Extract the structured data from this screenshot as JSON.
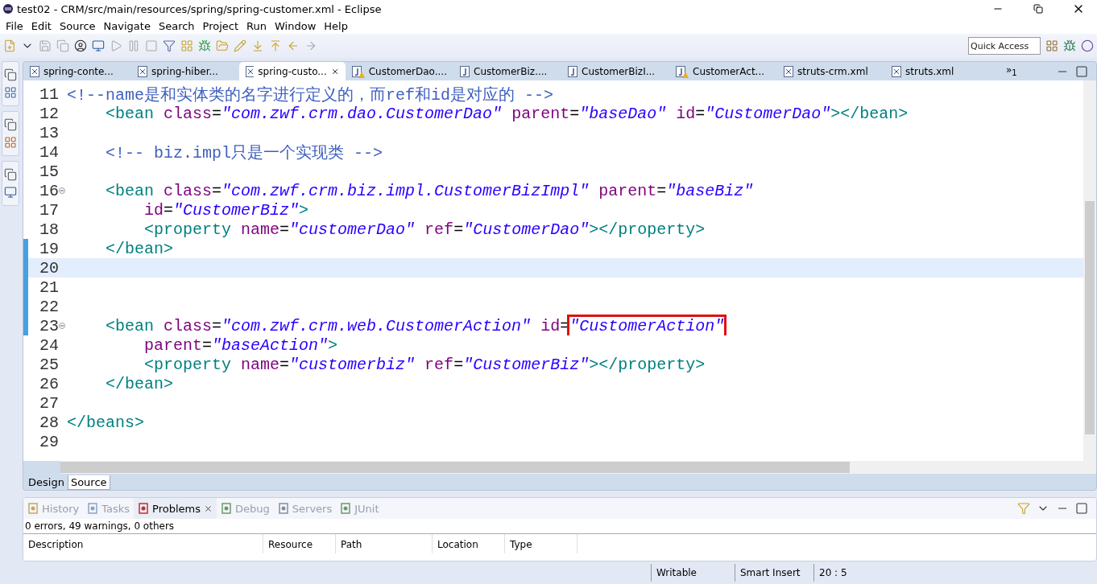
{
  "window": {
    "title": "test02 - CRM/src/main/resources/spring/spring-customer.xml - Eclipse"
  },
  "menu": [
    "File",
    "Edit",
    "Source",
    "Navigate",
    "Search",
    "Project",
    "Run",
    "Window",
    "Help"
  ],
  "quick_access": {
    "placeholder": "Quick Access"
  },
  "editor_tabs": [
    {
      "label": "spring-conte...",
      "kind": "xml",
      "selected": false,
      "warning": false
    },
    {
      "label": "spring-hiber...",
      "kind": "xml",
      "selected": false,
      "warning": false
    },
    {
      "label": "spring-custo...",
      "kind": "xml",
      "selected": true,
      "warning": false
    },
    {
      "label": "CustomerDao....",
      "kind": "java",
      "selected": false,
      "warning": true
    },
    {
      "label": "CustomerBiz....",
      "kind": "java",
      "selected": false,
      "warning": false
    },
    {
      "label": "CustomerBizI...",
      "kind": "java",
      "selected": false,
      "warning": false
    },
    {
      "label": "CustomerAct...",
      "kind": "java",
      "selected": false,
      "warning": true
    },
    {
      "label": "struts-crm.xml",
      "kind": "xml",
      "selected": false,
      "warning": false
    },
    {
      "label": "struts.xml",
      "kind": "xml",
      "selected": false,
      "warning": false
    }
  ],
  "more_tabs": {
    "symbol": "»",
    "count": "1"
  },
  "code_lines": [
    {
      "number": "11",
      "fold": false,
      "changed": false,
      "current": false,
      "tokens": [
        {
          "kind": "comment",
          "text": "<!--name是和实体类的名字进行定义的，而ref和id是对应的 -->"
        }
      ]
    },
    {
      "number": "12",
      "fold": false,
      "changed": false,
      "current": false,
      "tokens": [
        {
          "kind": "tag",
          "text": "    <bean "
        },
        {
          "kind": "attr",
          "text": "class"
        },
        {
          "kind": "eq",
          "text": "="
        },
        {
          "kind": "str",
          "text": "\"com.zwf.crm.dao.CustomerDao\""
        },
        {
          "kind": "attr",
          "text": " parent"
        },
        {
          "kind": "eq",
          "text": "="
        },
        {
          "kind": "str",
          "text": "\"baseDao\""
        },
        {
          "kind": "attr",
          "text": " id"
        },
        {
          "kind": "eq",
          "text": "="
        },
        {
          "kind": "str",
          "text": "\"CustomerDao\""
        },
        {
          "kind": "tag",
          "text": "></bean>"
        }
      ]
    },
    {
      "number": "13",
      "fold": false,
      "changed": false,
      "current": false
    },
    {
      "number": "14",
      "fold": false,
      "changed": false,
      "current": false,
      "tokens": [
        {
          "kind": "comment",
          "text": "    <!-- biz.impl只是一个实现类 -->"
        }
      ]
    },
    {
      "number": "15",
      "fold": false,
      "changed": false,
      "current": false
    },
    {
      "number": "16",
      "fold": true,
      "changed": false,
      "current": false,
      "tokens": [
        {
          "kind": "tag",
          "text": "    <bean "
        },
        {
          "kind": "attr",
          "text": "class"
        },
        {
          "kind": "eq",
          "text": "="
        },
        {
          "kind": "str",
          "text": "\"com.zwf.crm.biz.impl.CustomerBizImpl\""
        },
        {
          "kind": "attr",
          "text": " parent"
        },
        {
          "kind": "eq",
          "text": "="
        },
        {
          "kind": "str",
          "text": "\"baseBiz\""
        }
      ]
    },
    {
      "number": "17",
      "fold": false,
      "changed": false,
      "current": false,
      "tokens": [
        {
          "kind": "attr",
          "text": "        id"
        },
        {
          "kind": "eq",
          "text": "="
        },
        {
          "kind": "str",
          "text": "\"CustomerBiz\""
        },
        {
          "kind": "tag",
          "text": ">"
        }
      ]
    },
    {
      "number": "18",
      "fold": false,
      "changed": false,
      "current": false,
      "tokens": [
        {
          "kind": "tag",
          "text": "        <property "
        },
        {
          "kind": "attr",
          "text": "name"
        },
        {
          "kind": "eq",
          "text": "="
        },
        {
          "kind": "str",
          "text": "\"customerDao\""
        },
        {
          "kind": "attr",
          "text": " ref"
        },
        {
          "kind": "eq",
          "text": "="
        },
        {
          "kind": "str",
          "text": "\"CustomerDao\""
        },
        {
          "kind": "tag",
          "text": "></property>"
        }
      ]
    },
    {
      "number": "19",
      "fold": false,
      "changed": true,
      "current": false,
      "tokens": [
        {
          "kind": "tag",
          "text": "    </bean>"
        }
      ]
    },
    {
      "number": "20",
      "fold": false,
      "changed": true,
      "current": true
    },
    {
      "number": "21",
      "fold": false,
      "changed": true,
      "current": false
    },
    {
      "number": "22",
      "fold": false,
      "changed": true,
      "current": false
    },
    {
      "number": "23",
      "fold": true,
      "changed": true,
      "current": false,
      "tokens": [
        {
          "kind": "tag",
          "text": "    <bean "
        },
        {
          "kind": "attr",
          "text": "class"
        },
        {
          "kind": "eq",
          "text": "="
        },
        {
          "kind": "str",
          "text": "\"com.zwf.crm.web.CustomerAction\""
        },
        {
          "kind": "attr",
          "text": " id"
        },
        {
          "kind": "eq",
          "text": "="
        },
        {
          "kind": "str",
          "text": "\"CustomerAction\"",
          "highlighted": true
        }
      ]
    },
    {
      "number": "24",
      "fold": false,
      "changed": false,
      "current": false,
      "tokens": [
        {
          "kind": "attr",
          "text": "        parent"
        },
        {
          "kind": "eq",
          "text": "="
        },
        {
          "kind": "str",
          "text": "\"baseAction\""
        },
        {
          "kind": "tag",
          "text": ">"
        }
      ]
    },
    {
      "number": "25",
      "fold": false,
      "changed": false,
      "current": false,
      "tokens": [
        {
          "kind": "tag",
          "text": "        <property "
        },
        {
          "kind": "attr",
          "text": "name"
        },
        {
          "kind": "eq",
          "text": "="
        },
        {
          "kind": "str",
          "text": "\"customerbiz\""
        },
        {
          "kind": "attr",
          "text": " ref"
        },
        {
          "kind": "eq",
          "text": "="
        },
        {
          "kind": "str",
          "text": "\"CustomerBiz\""
        },
        {
          "kind": "tag",
          "text": "></property>"
        }
      ]
    },
    {
      "number": "26",
      "fold": false,
      "changed": false,
      "current": false,
      "tokens": [
        {
          "kind": "tag",
          "text": "    </bean>"
        }
      ]
    },
    {
      "number": "27",
      "fold": false,
      "changed": false,
      "current": false
    },
    {
      "number": "28",
      "fold": false,
      "changed": false,
      "current": false,
      "tokens": [
        {
          "kind": "tag",
          "text": "</beans>"
        }
      ]
    },
    {
      "number": "29",
      "fold": false,
      "changed": false,
      "current": false
    }
  ],
  "editor_mode_tabs": [
    {
      "label": "Design",
      "selected": false
    },
    {
      "label": "Source",
      "selected": true
    }
  ],
  "bottom_tabs": [
    {
      "label": "History",
      "selected": false,
      "kind": "history"
    },
    {
      "label": "Tasks",
      "selected": false,
      "kind": "tasks"
    },
    {
      "label": "Problems",
      "selected": true,
      "kind": "problems"
    },
    {
      "label": "Debug",
      "selected": false,
      "kind": "debug"
    },
    {
      "label": "Servers",
      "selected": false,
      "kind": "servers"
    },
    {
      "label": "JUnit",
      "selected": false,
      "kind": "junit"
    }
  ],
  "problems": {
    "summary": "0 errors, 49 warnings, 0 others",
    "columns": [
      "Description",
      "Resource",
      "Path",
      "Location",
      "Type"
    ]
  },
  "status_bar": [
    "Writable",
    "Smart Insert",
    "20 : 5"
  ]
}
